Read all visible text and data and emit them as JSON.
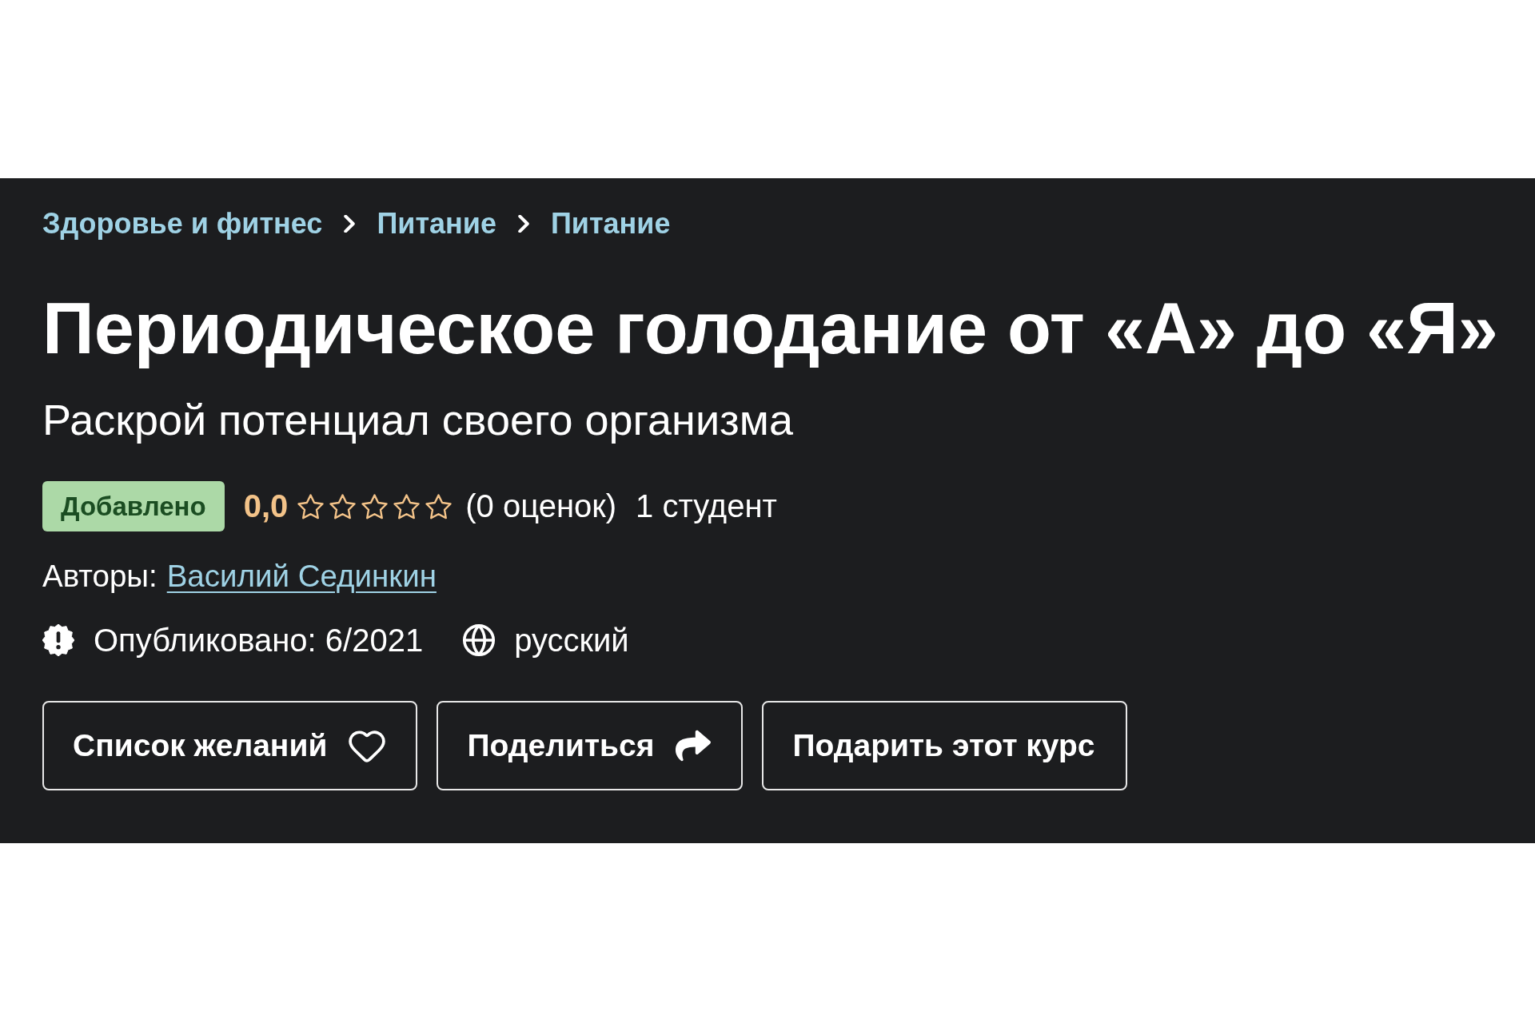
{
  "breadcrumbs": [
    {
      "label": "Здоровье и фитнес"
    },
    {
      "label": "Питание"
    },
    {
      "label": "Питание"
    }
  ],
  "course": {
    "title": "Периодическое голодание от «А» до «Я»",
    "subtitle": "Раскрой потенциал своего организма"
  },
  "stats": {
    "badge": "Добавлено",
    "rating": "0,0",
    "stars": 0,
    "ratings_count": "(0 оценок)",
    "students": "1 студент"
  },
  "authors": {
    "label": "Авторы:",
    "names": [
      "Василий Сединкин"
    ]
  },
  "meta": [
    {
      "kind": "published",
      "text": "Опубликовано: 6/2021"
    },
    {
      "kind": "language",
      "text": "русский"
    }
  ],
  "buttons": [
    {
      "kind": "wishlist",
      "label": "Список желаний"
    },
    {
      "kind": "share",
      "label": "Поделиться"
    },
    {
      "kind": "gift",
      "label": "Подарить этот курс"
    }
  ]
}
